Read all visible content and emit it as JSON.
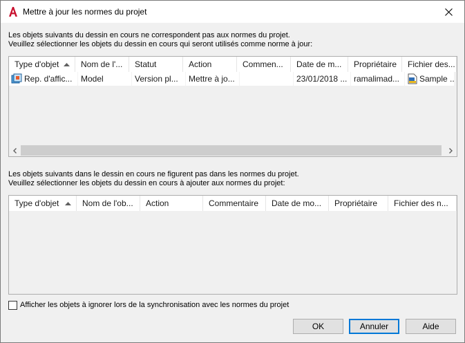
{
  "window": {
    "title": "Mettre à jour les normes du projet"
  },
  "section1": {
    "line1": "Les objets suivants du dessin en cours ne correspondent pas aux normes du projet.",
    "line2": "Veuillez sélectionner les objets du dessin en cours qui seront utilisés comme norme à jour:",
    "columns": [
      "Type d'objet",
      "Nom de l'...",
      "Statut",
      "Action",
      "Commen...",
      "Date de m...",
      "Propriétaire",
      "Fichier des..."
    ],
    "sort_column": "Type d'objet",
    "rows": [
      {
        "type": "Rep. d'affic...",
        "type_icon": "layer-state-icon",
        "name": "Model",
        "status": "Version pl...",
        "action": "Mettre à jo...",
        "comment": "",
        "date": "23/01/2018 ...",
        "owner": "ramalimad...",
        "file": "Sample ...",
        "file_icon": "standards-file-icon"
      }
    ]
  },
  "section2": {
    "line1": "Les objets suivants dans le dessin en cours ne figurent pas dans les normes du projet.",
    "line2": "Veuillez sélectionner les objets du dessin en cours à ajouter aux normes du projet:",
    "columns": [
      "Type d'objet",
      "Nom de l'ob...",
      "Action",
      "Commentaire",
      "Date de mo...",
      "Propriétaire",
      "Fichier des n..."
    ],
    "sort_column": "Type d'objet",
    "rows": []
  },
  "options": {
    "show_ignored_label": "Afficher les objets à ignorer lors de la synchronisation avec les normes du projet",
    "show_ignored_checked": false
  },
  "buttons": {
    "ok": "OK",
    "cancel": "Annuler",
    "help": "Aide"
  },
  "colors": {
    "app_icon": "#c8102e",
    "scroll_thumb": "#cdcdcd",
    "default_button_border": "#0078d7"
  }
}
